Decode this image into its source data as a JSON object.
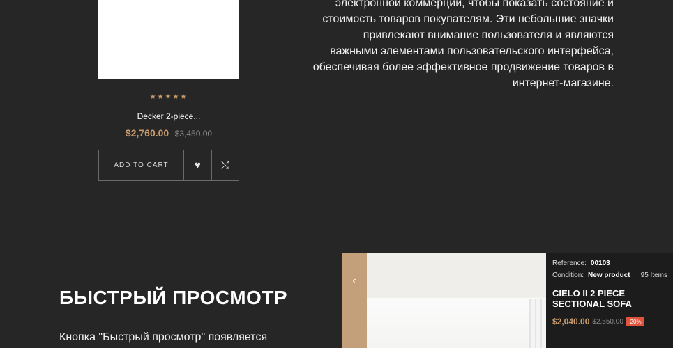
{
  "product": {
    "rating_stars": "★★★★★",
    "name": "Decker 2-piece...",
    "price": "$2,760.00",
    "old_price": "$3,450.00",
    "add_to_cart_label": "ADD TO CART",
    "wishlist_icon": "♥",
    "compare_icon": "⤭"
  },
  "description": {
    "lines": [
      "электронной коммерции, чтобы показать состояние и",
      "стоимость товаров покупателям. Эти небольшие значки",
      "привлекают внимание пользователя и являются",
      "важными элементами пользовательского интерфейса,",
      "обеспечивая более эффективное продвижение товаров в",
      "интернет-магазине."
    ]
  },
  "quick_view_section": {
    "title": "БЫСТРЫЙ ПРОСМОТР",
    "text": "Кнопка \"Быстрый просмотр\" появляется"
  },
  "preview": {
    "prev_icon": "‹",
    "reference_label": "Reference:",
    "reference_value": "00103",
    "condition_label": "Condition:",
    "condition_value": "New product",
    "items_count": "95 Items",
    "title": "CIELO II 2 PIECE SECTIONAL SOFA",
    "price": "$2,040.00",
    "old_price": "$2,550.00",
    "discount": "-20%"
  },
  "colors": {
    "background": "#262626",
    "accent": "#c89b6d",
    "badge": "#e0533c"
  }
}
